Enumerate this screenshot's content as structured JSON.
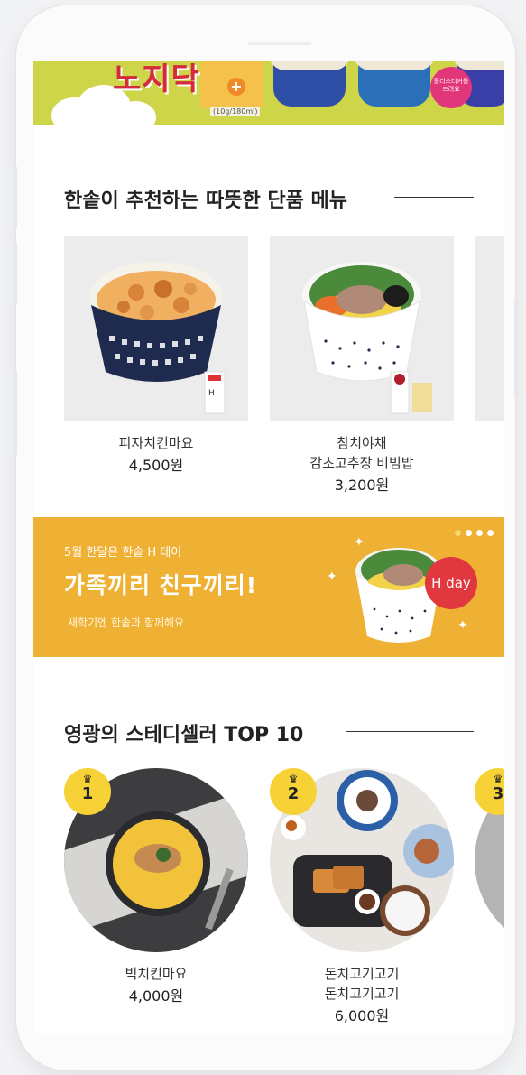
{
  "top_banner": {
    "brand_text": "노지닥",
    "juice_caption": "(10g/180ml)",
    "sticker_text": "홀리스티커를 드려요"
  },
  "section_recommend": {
    "title": "한솥이 추천하는 따뜻한 단품 메뉴",
    "items": [
      {
        "name": "피자치킨마요",
        "price": "4,500원"
      },
      {
        "name": "참치야채",
        "name2": "감초고추장 비빔밥",
        "price": "3,200원"
      }
    ]
  },
  "hday_banner": {
    "sub": "5월 한달은 한솥 H 데이",
    "main": "가족끼리 친구끼리!",
    "desc": "새학기엔 한솥과 함께해요",
    "badge": "H day",
    "slide_count": 4,
    "active_slide": 1
  },
  "section_top10": {
    "title": "영광의 스테디셀러 TOP 10",
    "crown_icon": "crown-icon",
    "items": [
      {
        "rank": "1",
        "name": "빅치킨마요",
        "price": "4,000원"
      },
      {
        "rank": "2",
        "name": "돈치고기고기",
        "name2": "돈치고기고기",
        "price": "6,000원"
      },
      {
        "rank": "3"
      }
    ]
  },
  "colors": {
    "banner_green": "#cfd548",
    "hday_yellow": "#efb134",
    "hday_badge": "#e0383e",
    "rank_yellow": "#f7d236"
  }
}
